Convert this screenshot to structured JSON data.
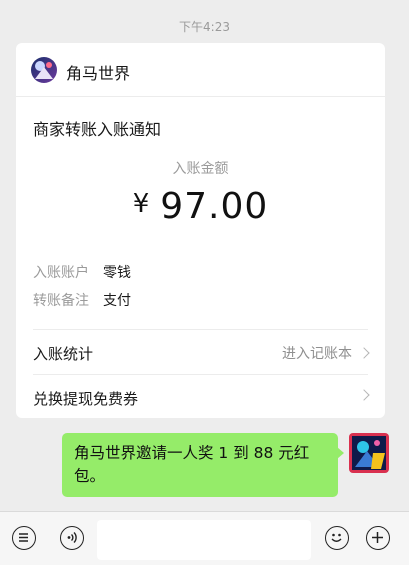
{
  "chat": {
    "timestamp": "下午4:23"
  },
  "card": {
    "app_name": "角马世界",
    "notice_title": "商家转账入账通知",
    "amount_label": "入账金额",
    "currency": "¥",
    "amount": "97.00",
    "rows": [
      {
        "key": "入账账户",
        "value": "零钱"
      },
      {
        "key": "转账备注",
        "value": "支付"
      }
    ],
    "stats_label": "入账统计",
    "stats_link": "进入记账本",
    "voucher_label": "兑换提现免费券"
  },
  "message": {
    "text": "角马世界邀请一人奖 1 到 88 元红包。"
  },
  "input_bar": {
    "voice_icon": "voice-icon",
    "emoji_icon": "emoji-icon",
    "plus_icon": "plus-icon",
    "menu_icon": "menu-list-icon"
  },
  "colors": {
    "background": "#ededed",
    "bubble": "#95ec69",
    "card": "#ffffff"
  }
}
